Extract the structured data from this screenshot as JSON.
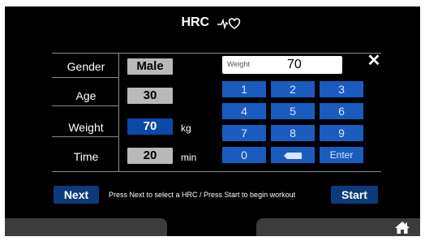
{
  "header": {
    "title": "HRC",
    "icon": "heart-rate-icon"
  },
  "form": {
    "rows": [
      {
        "label": "Gender",
        "value": "Male",
        "unit": ""
      },
      {
        "label": "Age",
        "value": "30",
        "unit": ""
      },
      {
        "label": "Weight",
        "value": "70",
        "unit": "kg"
      },
      {
        "label": "Time",
        "value": "20",
        "unit": "min"
      }
    ],
    "active_row": "Weight"
  },
  "keypad": {
    "display_label": "Weight",
    "display_value": "70",
    "keys": [
      "1",
      "2",
      "3",
      "4",
      "5",
      "6",
      "7",
      "8",
      "9",
      "0",
      "backspace",
      "Enter"
    ],
    "close_icon": "close-icon"
  },
  "footer": {
    "next_label": "Next",
    "hint": "Press Next to select a HRC  /  Press Start to begin workout",
    "start_label": "Start",
    "home_icon": "home-icon"
  },
  "colors": {
    "accent": "#1a5bbf",
    "active_value": "#0b4aa6",
    "button": "#0d3a7a",
    "value_box": "#b9b9b9"
  }
}
